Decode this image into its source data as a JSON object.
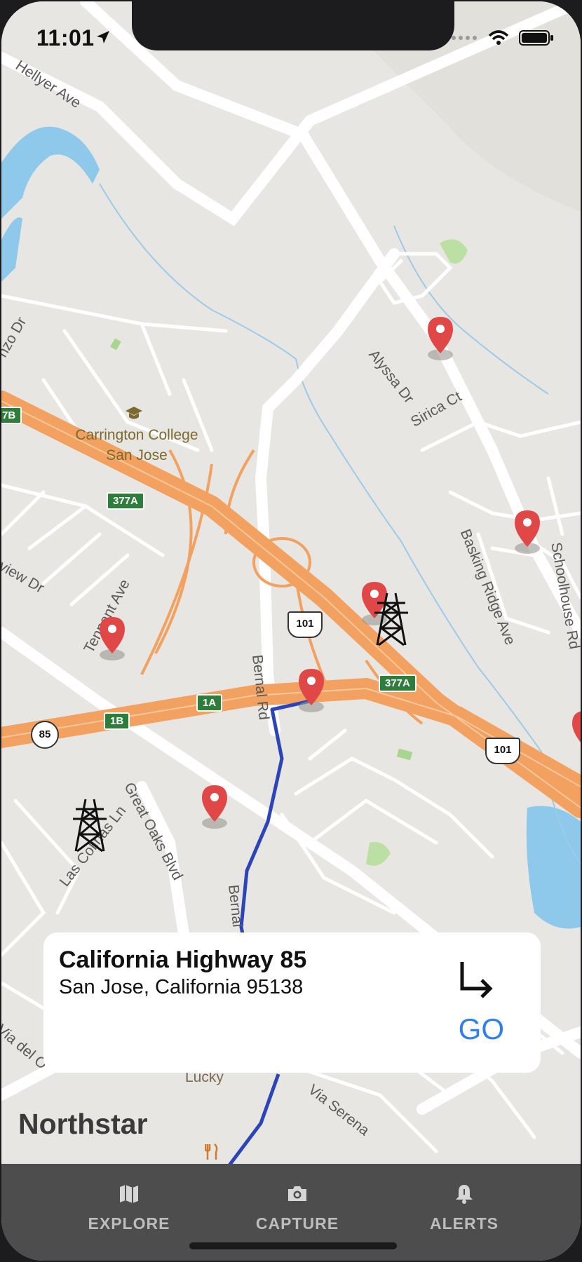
{
  "status_bar": {
    "time": "11:01"
  },
  "map": {
    "street_labels": [
      "Hellyer Ave",
      "Alyssa Dr",
      "Sirica Ct",
      "Basking Ridge Ave",
      "Schoolhouse Rd",
      "Bernal Rd",
      "Great Oaks Blvd",
      "Las Colinas Ln",
      "Via Serena",
      "Via del O",
      "nzo Dr",
      "view Dr",
      "Tennant Ave",
      "Bernal"
    ],
    "poi": {
      "college_name": "Carrington College San Jose",
      "store_name": "Lucky"
    },
    "highway_shields": [
      "377A",
      "377A",
      "1A",
      "1B",
      "7B"
    ],
    "us_route_shields": [
      "101",
      "101"
    ],
    "state_route_shields": [
      "85"
    ],
    "colors": {
      "route": "#2b45b8",
      "freeway": "#f2a160",
      "pin": "#e04848",
      "water": "#8ec9ec"
    }
  },
  "location_card": {
    "title": "California Highway 85",
    "subtitle": "San Jose, California 95138",
    "go_label": "GO"
  },
  "brand": "Northstar",
  "tabs": [
    {
      "label": "EXPLORE",
      "icon": "map-icon"
    },
    {
      "label": "CAPTURE",
      "icon": "camera-icon"
    },
    {
      "label": "ALERTS",
      "icon": "bell-icon"
    }
  ]
}
